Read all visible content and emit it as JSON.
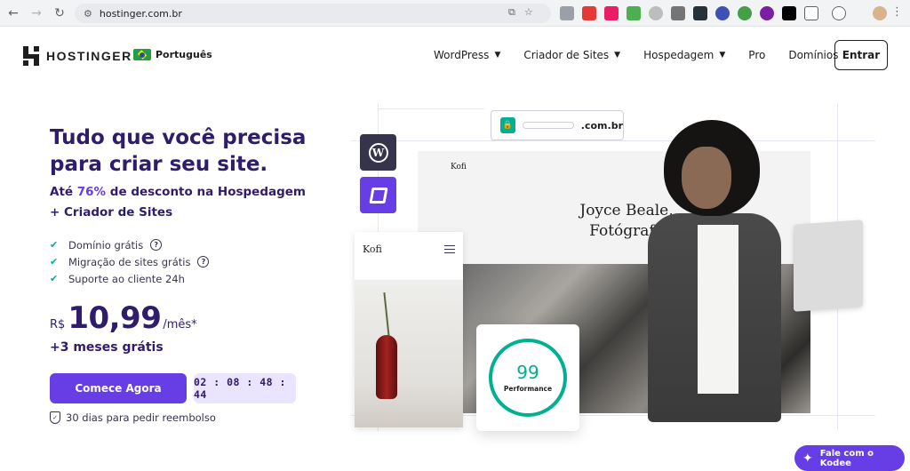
{
  "browser": {
    "url": "hostinger.com.br",
    "icons": [
      "back-icon",
      "forward-icon",
      "reload-icon",
      "tune-icon",
      "install-app-icon",
      "bookmark-star-icon",
      "extensions-icon",
      "profile-icon",
      "more-icon"
    ]
  },
  "header": {
    "logo_text": "HOSTINGER",
    "language": "Português",
    "nav": [
      {
        "label": "WordPress",
        "has_dropdown": true
      },
      {
        "label": "Criador de Sites",
        "has_dropdown": true
      },
      {
        "label": "Hospedagem",
        "has_dropdown": true
      },
      {
        "label": "Pro",
        "has_dropdown": false
      },
      {
        "label": "Domínios",
        "has_dropdown": false
      }
    ],
    "login_label": "Entrar"
  },
  "hero": {
    "title": "Tudo que você precisa para criar seu site.",
    "subtitle_before": "Até ",
    "subtitle_pct": "76%",
    "subtitle_after": " de desconto na Hospedagem + Criador de Sites",
    "features": [
      {
        "text": "Domínio grátis",
        "help": true
      },
      {
        "text": "Migração de sites grátis",
        "help": true
      },
      {
        "text": "Suporte ao cliente 24h",
        "help": false
      }
    ],
    "price_currency": "R$",
    "price_amount": "10,99",
    "price_period": "/mês*",
    "bonus": "+3 meses grátis",
    "cta_label": "Comece Agora",
    "timer": "02 : 08 : 48 : 44",
    "guarantee": "30 dias para pedir reembolso"
  },
  "art": {
    "domain_suffix": ".com.br",
    "site_brand": "Kofi",
    "site_headline": "Joyce Beale, Fotógrafa",
    "mobile_brand": "Kofi",
    "performance_score": "99",
    "performance_label": "Performance"
  },
  "chat": {
    "label": "Fale com o Kodee"
  },
  "colors": {
    "brand_purple": "#673de6",
    "heading": "#2f1c6a",
    "success_green": "#00b090"
  }
}
